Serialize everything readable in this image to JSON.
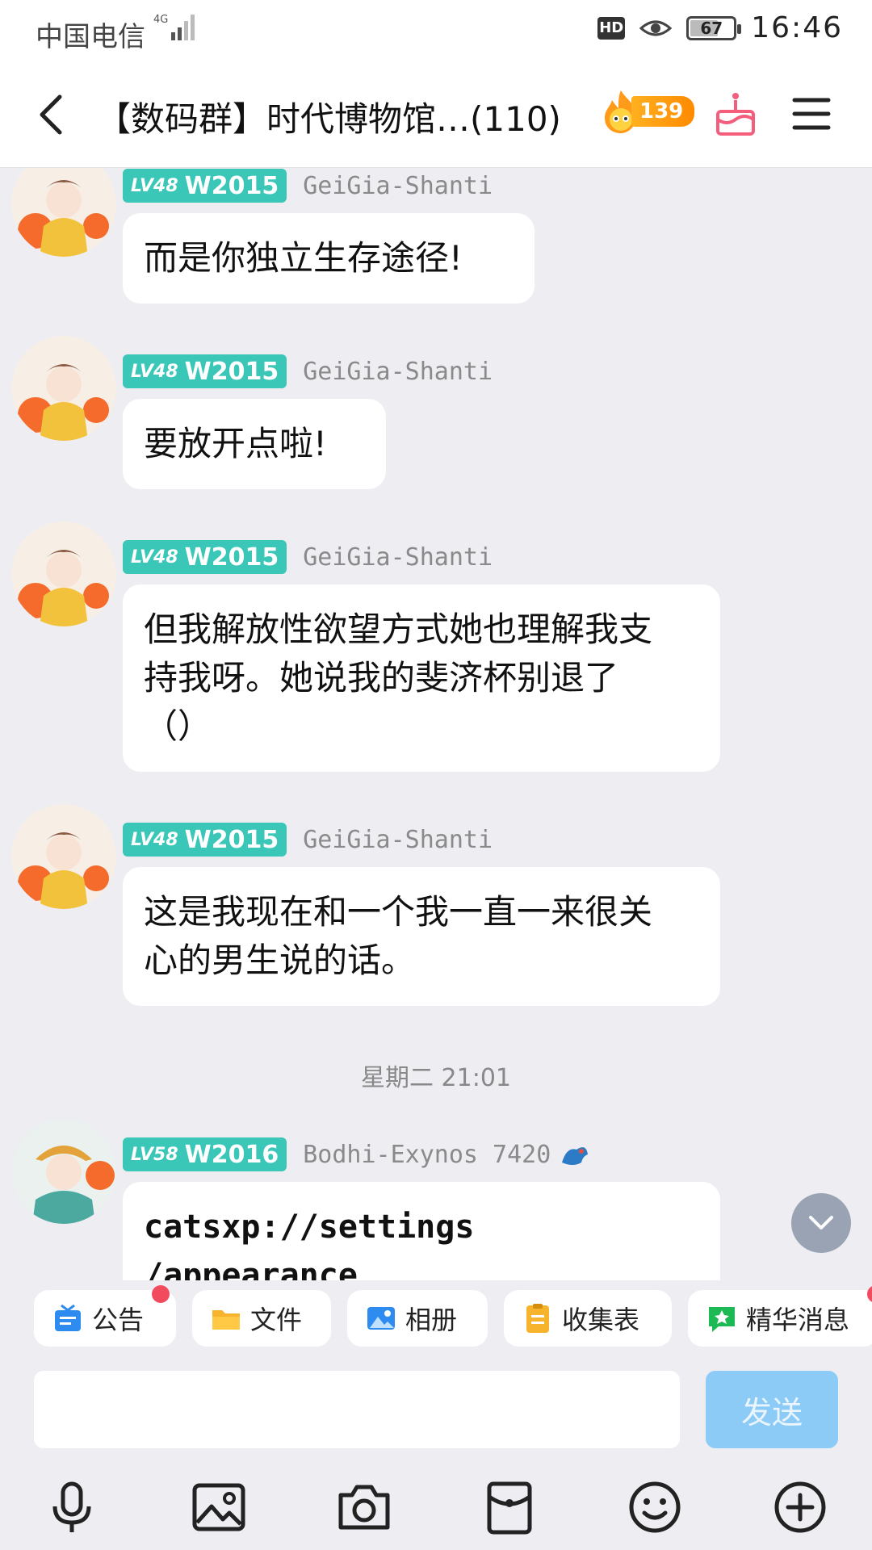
{
  "status_bar": {
    "carrier": "中国电信",
    "network": "4G",
    "battery": "67",
    "time": "16:46"
  },
  "header": {
    "title": "【数码群】时代博物馆…(110)",
    "fire_count": "139",
    "accent": "#3BC7B8"
  },
  "messages": [
    {
      "level": "LV48",
      "tag": "W2015",
      "sender": "GeiGia-Shanti",
      "text": "而是你独立生存途径!"
    },
    {
      "level": "LV48",
      "tag": "W2015",
      "sender": "GeiGia-Shanti",
      "text": "要放开点啦!"
    },
    {
      "level": "LV48",
      "tag": "W2015",
      "sender": "GeiGia-Shanti",
      "text_lines": [
        "但我解放性欲望方式她也理解我支",
        "持我呀。她说我的斐济杯别退了",
        "（）"
      ]
    },
    {
      "level": "LV48",
      "tag": "W2015",
      "sender": "GeiGia-Shanti",
      "text_lines": [
        "这是我现在和一个我一直一来很关",
        "心的男生说的话。"
      ]
    },
    {
      "level": "LV58",
      "tag": "W2016",
      "sender": "Bodhi-Exynos 7420",
      "text_lines": [
        "catsxp://settings",
        "/appearance"
      ]
    }
  ],
  "time_separator": "星期二 21:01",
  "quick_actions": [
    {
      "label": "公告",
      "icon": "announcement-icon",
      "dot": true
    },
    {
      "label": "文件",
      "icon": "folder-icon",
      "dot": false
    },
    {
      "label": "相册",
      "icon": "album-icon",
      "dot": false
    },
    {
      "label": "收集表",
      "icon": "form-icon",
      "dot": false
    },
    {
      "label": "精华消息",
      "icon": "essence-icon",
      "dot": true
    }
  ],
  "input": {
    "placeholder": "",
    "value": "",
    "send_label": "发送"
  },
  "toolbar": [
    "microphone-icon",
    "image-icon",
    "camera-icon",
    "red-packet-icon",
    "emoji-icon",
    "plus-icon"
  ]
}
